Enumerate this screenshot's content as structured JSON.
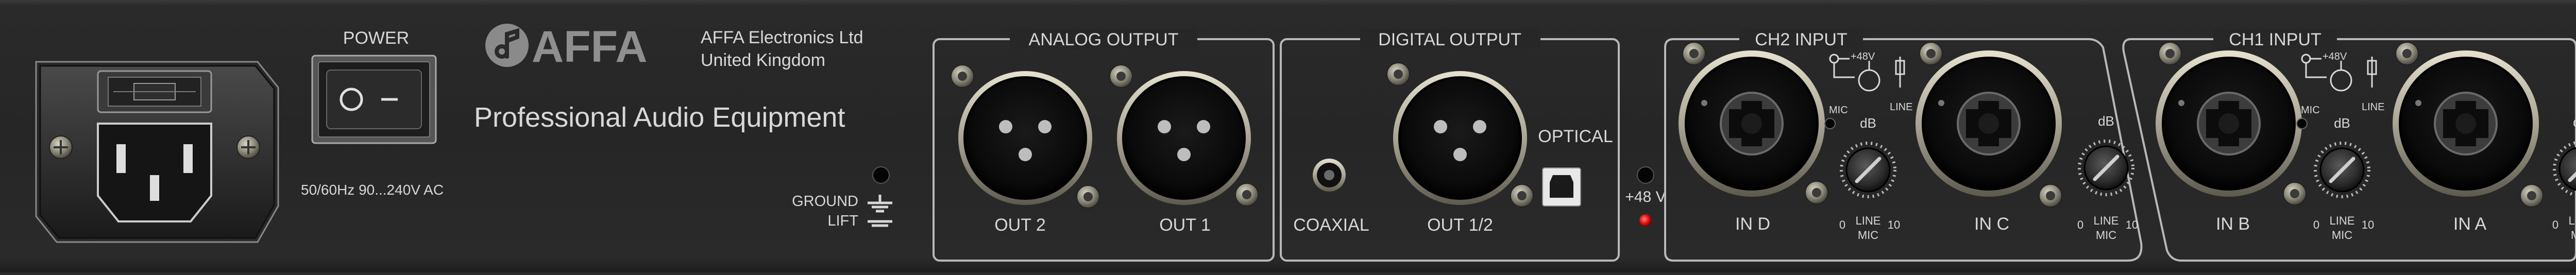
{
  "power": {
    "label": "POWER",
    "spec": "50/60Hz 90...240V AC"
  },
  "brand": {
    "logo_text": "AFFA",
    "company_line1": "AFFA Electronics Ltd",
    "company_line2": "United Kingdom",
    "tagline": "Professional Audio Equipment"
  },
  "ground_lift": {
    "line1": "GROUND",
    "line2": "LIFT"
  },
  "analog_output": {
    "title": "ANALOG OUTPUT",
    "out2": "OUT 2",
    "out1": "OUT 1"
  },
  "digital_output": {
    "title": "DIGITAL OUTPUT",
    "coaxial": "COAXIAL",
    "out12": "OUT 1/2",
    "optical": "OPTICAL"
  },
  "phantom": {
    "label": "+48 V"
  },
  "ch2": {
    "title": "CH2 INPUT",
    "in_d": "IN D",
    "in_c": "IN C"
  },
  "ch1": {
    "title": "CH1 INPUT",
    "in_b": "IN B",
    "in_a": "IN A"
  },
  "switch_diagram": {
    "plus48": "+48V",
    "mic": "MIC",
    "line": "LINE"
  },
  "gain": {
    "db": "dB",
    "min": "0",
    "max": "10",
    "line": "LINE",
    "mic": "MIC"
  },
  "colors": {
    "panel": "#2a2a2a",
    "text": "#d8d8d8",
    "accent_led": "#e01010"
  }
}
